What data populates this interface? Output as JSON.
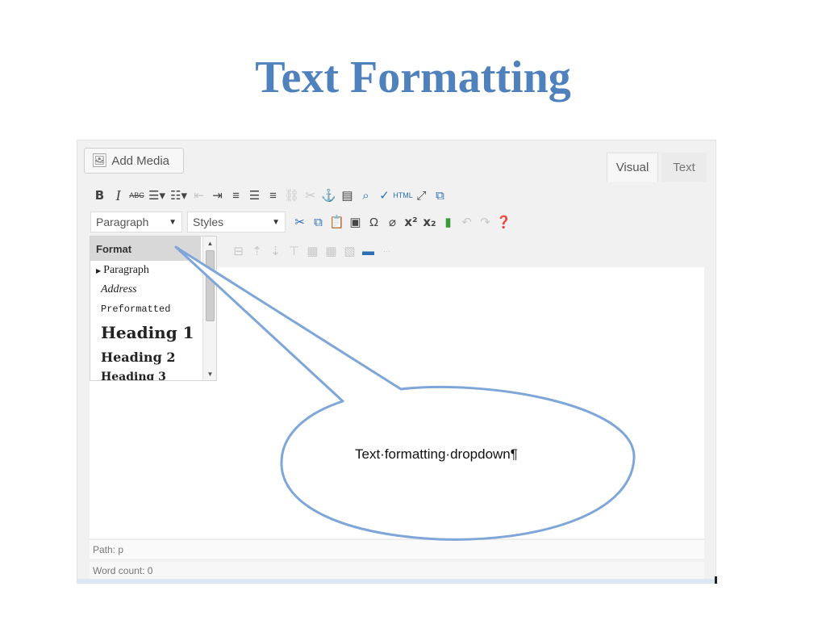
{
  "slide": {
    "title": "Text Formatting"
  },
  "editor": {
    "add_media_label": "Add Media",
    "tabs": {
      "visual": "Visual",
      "text": "Text"
    },
    "selects": {
      "paragraph": "Paragraph",
      "styles": "Styles"
    },
    "toolbar_row1": [
      "bold-icon",
      "italic-icon",
      "strikethrough-icon",
      "bullet-list-icon",
      "numbered-list-icon",
      "outdent-icon",
      "indent-icon",
      "align-left-icon",
      "align-center-icon",
      "align-right-icon",
      "link-icon",
      "unlink-icon",
      "anchor-icon",
      "read-more-icon",
      "find-replace-icon",
      "spellcheck-icon",
      "html-icon",
      "fullscreen-icon",
      "expand-toolbar-icon"
    ],
    "toolbar_row2": [
      "cut-icon",
      "copy-icon",
      "paste-icon",
      "paste-word-icon",
      "special-char-icon",
      "clear-format-icon",
      "superscript-icon",
      "subscript-icon",
      "media-icon",
      "undo-icon",
      "redo-icon",
      "help-icon"
    ],
    "format_panel": {
      "header": "Format",
      "items": [
        "Paragraph",
        "Address",
        "Preformatted",
        "Heading 1",
        "Heading 2",
        "Heading 3"
      ]
    },
    "status": {
      "path": "Path: p",
      "word_count": "Word count: 0"
    }
  },
  "callout": {
    "text": "Text·formatting·dropdown¶"
  }
}
